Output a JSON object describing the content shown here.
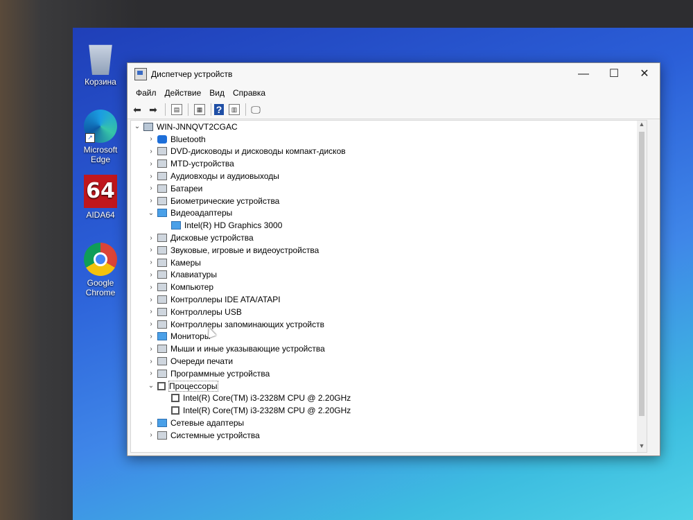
{
  "desktop": {
    "icons": [
      {
        "label": "Корзина",
        "icon": "recycle-bin-icon"
      },
      {
        "label": "Microsoft Edge",
        "icon": "edge-icon"
      },
      {
        "label": "AIDA64",
        "icon": "aida64-icon",
        "glyph": "64"
      },
      {
        "label": "Google Chrome",
        "icon": "chrome-icon"
      }
    ]
  },
  "window": {
    "title": "Диспетчер устройств",
    "controls": {
      "minimize": "—",
      "maximize": "☐",
      "close": "✕"
    },
    "menu": [
      "Файл",
      "Действие",
      "Вид",
      "Справка"
    ],
    "toolbar": [
      "back-icon",
      "forward-icon",
      "properties-icon",
      "update-driver-icon",
      "help-icon",
      "view-icon",
      "monitor-icon"
    ],
    "tree": {
      "root": "WIN-JNNQVT2CGAC",
      "items": [
        {
          "label": "Bluetooth",
          "expanded": false,
          "icon": "bluetooth-icon"
        },
        {
          "label": "DVD-дисководы и дисководы компакт-дисков",
          "expanded": false,
          "icon": "dvd-icon"
        },
        {
          "label": "MTD-устройства",
          "expanded": false,
          "icon": "mtd-icon"
        },
        {
          "label": "Аудиовходы и аудиовыходы",
          "expanded": false,
          "icon": "audio-icon"
        },
        {
          "label": "Батареи",
          "expanded": false,
          "icon": "battery-icon"
        },
        {
          "label": "Биометрические устройства",
          "expanded": false,
          "icon": "biometric-icon"
        },
        {
          "label": "Видеоадаптеры",
          "expanded": true,
          "icon": "display-adapter-icon",
          "children": [
            "Intel(R) HD Graphics 3000"
          ]
        },
        {
          "label": "Дисковые устройства",
          "expanded": false,
          "icon": "disk-icon"
        },
        {
          "label": "Звуковые, игровые и видеоустройства",
          "expanded": false,
          "icon": "sound-icon"
        },
        {
          "label": "Камеры",
          "expanded": false,
          "icon": "camera-icon"
        },
        {
          "label": "Клавиатуры",
          "expanded": false,
          "icon": "keyboard-icon"
        },
        {
          "label": "Компьютер",
          "expanded": false,
          "icon": "computer-icon"
        },
        {
          "label": "Контроллеры IDE ATA/ATAPI",
          "expanded": false,
          "icon": "ide-icon"
        },
        {
          "label": "Контроллеры USB",
          "expanded": false,
          "icon": "usb-icon"
        },
        {
          "label": "Контроллеры запоминающих устройств",
          "expanded": false,
          "icon": "storage-icon"
        },
        {
          "label": "Мониторы",
          "expanded": false,
          "icon": "monitor-icon"
        },
        {
          "label": "Мыши и иные указывающие устройства",
          "expanded": false,
          "icon": "mouse-icon"
        },
        {
          "label": "Очереди печати",
          "expanded": false,
          "icon": "printer-icon"
        },
        {
          "label": "Программные устройства",
          "expanded": false,
          "icon": "software-device-icon"
        },
        {
          "label": "Процессоры",
          "expanded": true,
          "icon": "processor-icon",
          "children": [
            "Intel(R) Core(TM) i3-2328M CPU @ 2.20GHz",
            "Intel(R) Core(TM) i3-2328M CPU @ 2.20GHz"
          ]
        },
        {
          "label": "Сетевые адаптеры",
          "expanded": false,
          "icon": "network-icon"
        },
        {
          "label": "Системные устройства",
          "expanded": false,
          "icon": "system-icon"
        }
      ]
    }
  }
}
